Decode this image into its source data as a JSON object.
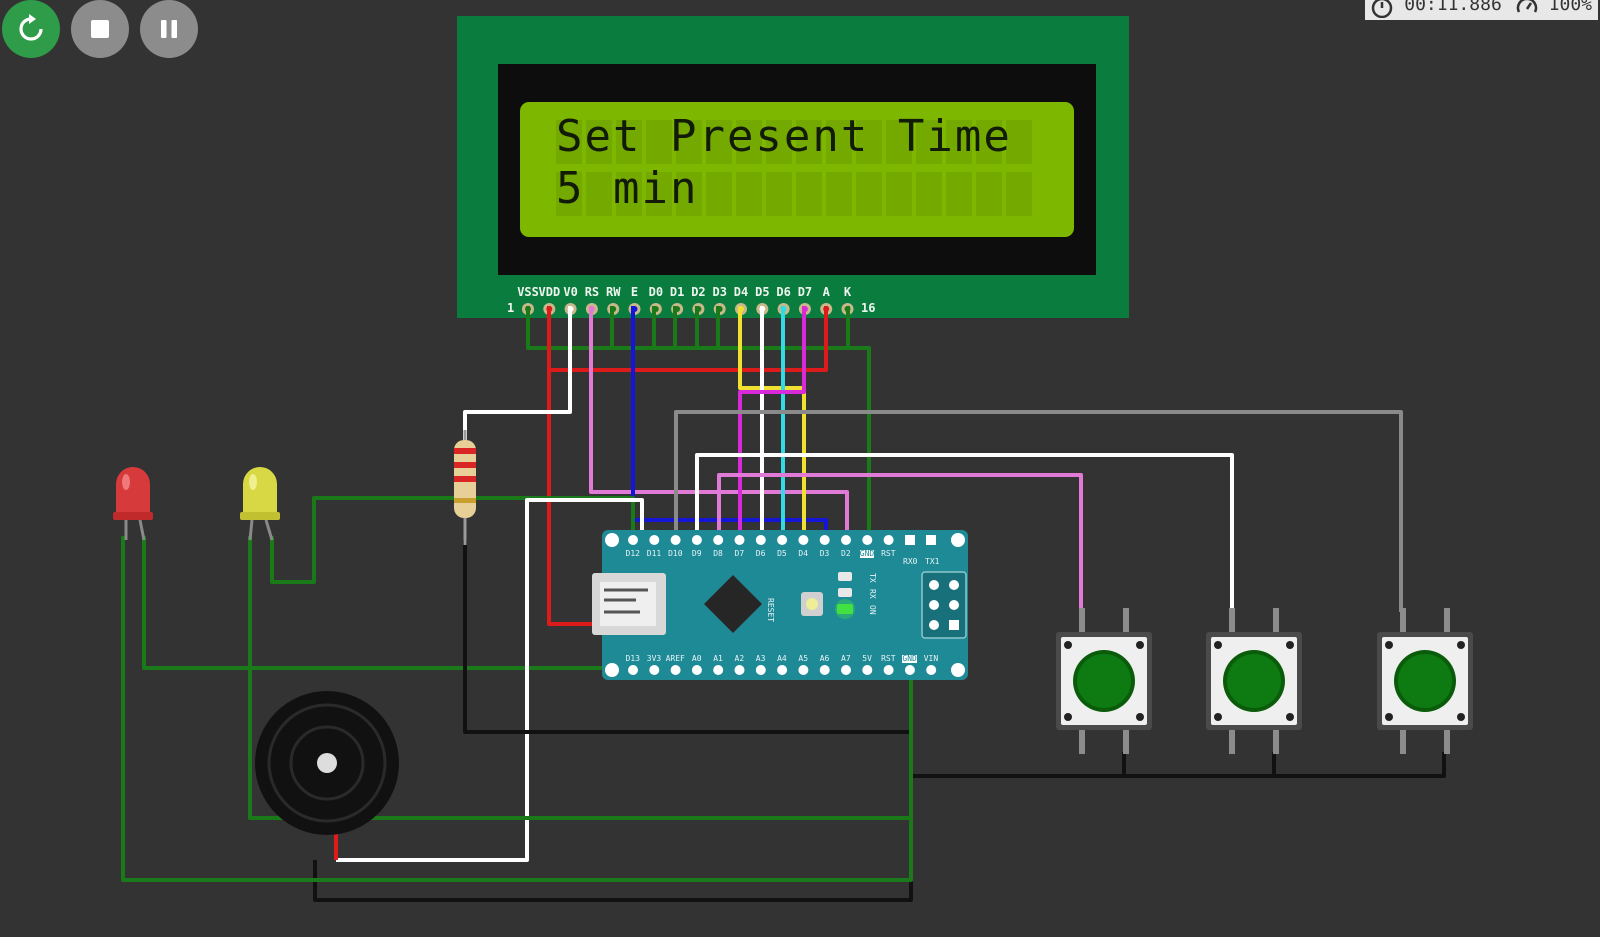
{
  "toolbar": {
    "restart_label": "restart",
    "stop_label": "stop",
    "pause_label": "pause",
    "colors": {
      "restart": "#2e9c49",
      "other": "#8c8c8c"
    }
  },
  "status": {
    "timer": "00:11.886",
    "speed": "100%",
    "icons": [
      "timer-icon",
      "speed-gauge-icon"
    ]
  },
  "lcd": {
    "line1": "Set Present Time",
    "line2": "5 min",
    "pin_labels": [
      "VSS",
      "VDD",
      "V0",
      "RS",
      "RW",
      "E",
      "D0",
      "D1",
      "D2",
      "D3",
      "D4",
      "D5",
      "D6",
      "D7",
      "A",
      "K"
    ],
    "pin_first": "1",
    "pin_last": "16",
    "colors": {
      "pcb": "#0a7d3e",
      "bezel": "#0d0d0d",
      "screen": "#7db700"
    }
  },
  "nano": {
    "top_pins": [
      "D12",
      "D11",
      "D10",
      "D9",
      "D8",
      "D7",
      "D6",
      "D5",
      "D4",
      "D3",
      "D2",
      "GND",
      "RST",
      "RX0",
      "TX1"
    ],
    "bottom_pins": [
      "D13",
      "3V3",
      "AREF",
      "A0",
      "A1",
      "A2",
      "A3",
      "A4",
      "A5",
      "A6",
      "A7",
      "5V",
      "RST",
      "GND",
      "VIN"
    ],
    "reset_label": "RESET",
    "led_labels": [
      "TX",
      "RX",
      "ON"
    ],
    "colors": {
      "pcb": "#1e8a96"
    }
  },
  "components": {
    "leds": [
      "red-led",
      "yellow-led"
    ],
    "buttons": [
      "push-button-1",
      "push-button-2",
      "push-button-3"
    ],
    "resistor": "resistor",
    "buzzer": "buzzer"
  }
}
